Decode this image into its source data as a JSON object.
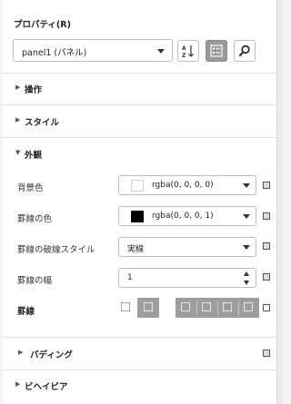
{
  "header": {
    "title": "プロパティ(R)"
  },
  "object_select": {
    "value": "panel1 (パネル)"
  },
  "toolbar": {
    "sort_icon": "sort-alpha-icon",
    "category_icon": "category-view-icon",
    "search_icon": "search-icon"
  },
  "sections": {
    "operation": {
      "title": "操作",
      "expanded": false
    },
    "style": {
      "title": "スタイル",
      "expanded": false
    },
    "appearance": {
      "title": "外観",
      "expanded": true
    },
    "padding": {
      "title": "パディング",
      "expanded": false
    },
    "behavior": {
      "title": "ビヘイビア",
      "expanded": false
    }
  },
  "appearance": {
    "background": {
      "label": "背景色",
      "value": "rgba(0, 0, 0, 0)",
      "swatch": "#ffffff"
    },
    "border_color": {
      "label": "罫線の色",
      "value": "rgba(0, 0, 0, 1)",
      "swatch": "#000000"
    },
    "border_style": {
      "label": "罫線の破線スタイル",
      "value": "実線"
    },
    "border_width": {
      "label": "罫線の幅",
      "value": "1"
    },
    "borders": {
      "label": "罫線"
    }
  },
  "colors": {
    "reset_fill": "#cfe3ec",
    "active_button": "#9a9a9a"
  }
}
